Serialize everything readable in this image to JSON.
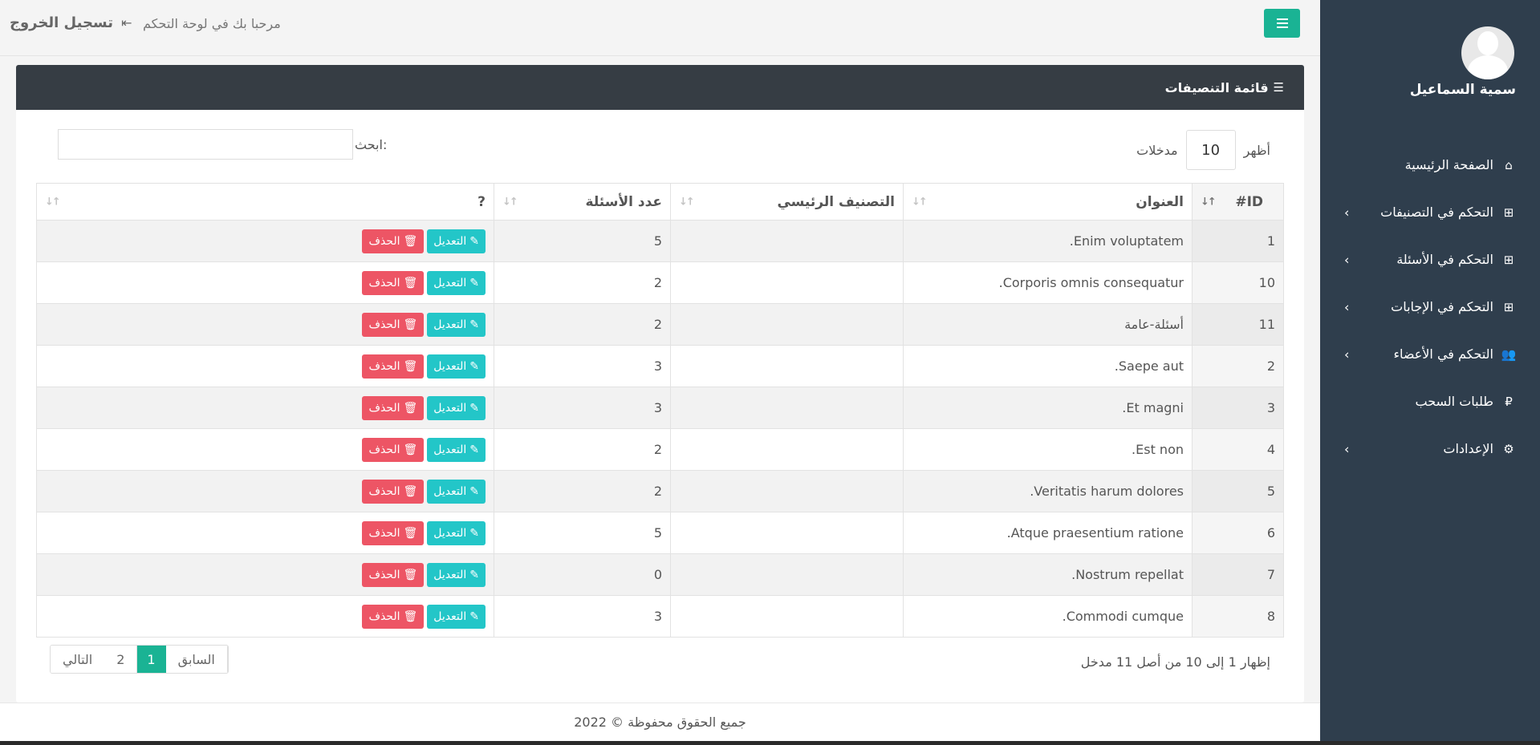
{
  "sidebar": {
    "user_name": "سمية السماعيل",
    "items": [
      {
        "label": "الصفحة الرئيسية",
        "icon": "home-icon",
        "glyph": "⌂",
        "has_submenu": false
      },
      {
        "label": "التحكم في التصنيفات",
        "icon": "grid-icon",
        "glyph": "⊞",
        "has_submenu": true
      },
      {
        "label": "التحكم في الأسئلة",
        "icon": "grid-icon",
        "glyph": "⊞",
        "has_submenu": true
      },
      {
        "label": "التحكم في الإجابات",
        "icon": "grid-icon",
        "glyph": "⊞",
        "has_submenu": true
      },
      {
        "label": "التحكم في الأعضاء",
        "icon": "users-icon",
        "glyph": "👥",
        "has_submenu": true
      },
      {
        "label": "طلبات السحب",
        "icon": "paypal-icon",
        "glyph": "₽",
        "has_submenu": false
      },
      {
        "label": "الإعدادات",
        "icon": "gear-icon",
        "glyph": "⚙",
        "has_submenu": true
      }
    ]
  },
  "topbar": {
    "welcome": "مرحبا بك في لوحة التحكم",
    "logout": "تسجيل الخروج"
  },
  "card": {
    "title": "قائمة التنصيفات"
  },
  "controls": {
    "show_label": "أظهر",
    "length_value": "10",
    "entries_label": "مدخلات",
    "search_label": "ابحث:",
    "search_value": ""
  },
  "table": {
    "columns": [
      "ID#",
      "العنوان",
      "التصنيف الرئيسي",
      "عدد الأسئلة",
      "?"
    ],
    "edit_label": "التعديل",
    "delete_label": "الحذف",
    "rows": [
      {
        "id": "1",
        "title": "Enim voluptatem.",
        "main": "",
        "count": "5"
      },
      {
        "id": "10",
        "title": "Corporis omnis consequatur.",
        "main": "",
        "count": "2"
      },
      {
        "id": "11",
        "title": "أسئلة-عامة",
        "main": "",
        "count": "2"
      },
      {
        "id": "2",
        "title": "Saepe aut.",
        "main": "",
        "count": "3"
      },
      {
        "id": "3",
        "title": "Et magni.",
        "main": "",
        "count": "3"
      },
      {
        "id": "4",
        "title": "Est non.",
        "main": "",
        "count": "2"
      },
      {
        "id": "5",
        "title": "Veritatis harum dolores.",
        "main": "",
        "count": "2"
      },
      {
        "id": "6",
        "title": "Atque praesentium ratione.",
        "main": "",
        "count": "5"
      },
      {
        "id": "7",
        "title": "Nostrum repellat.",
        "main": "",
        "count": "0"
      },
      {
        "id": "8",
        "title": "Commodi cumque.",
        "main": "",
        "count": "3"
      }
    ]
  },
  "info": "إظهار 1 إلى 10 من أصل 11 مدخل",
  "pagination": {
    "prev": "السابق",
    "pages": [
      "1",
      "2"
    ],
    "current": "1",
    "next": "التالي"
  },
  "footer": "جميع الحقوق محفوظة © 2022",
  "colors": {
    "sidebar": "#2f3e4d",
    "primary": "#1ab394",
    "edit": "#23c6c8",
    "delete": "#ed5565",
    "header": "#363d44"
  }
}
